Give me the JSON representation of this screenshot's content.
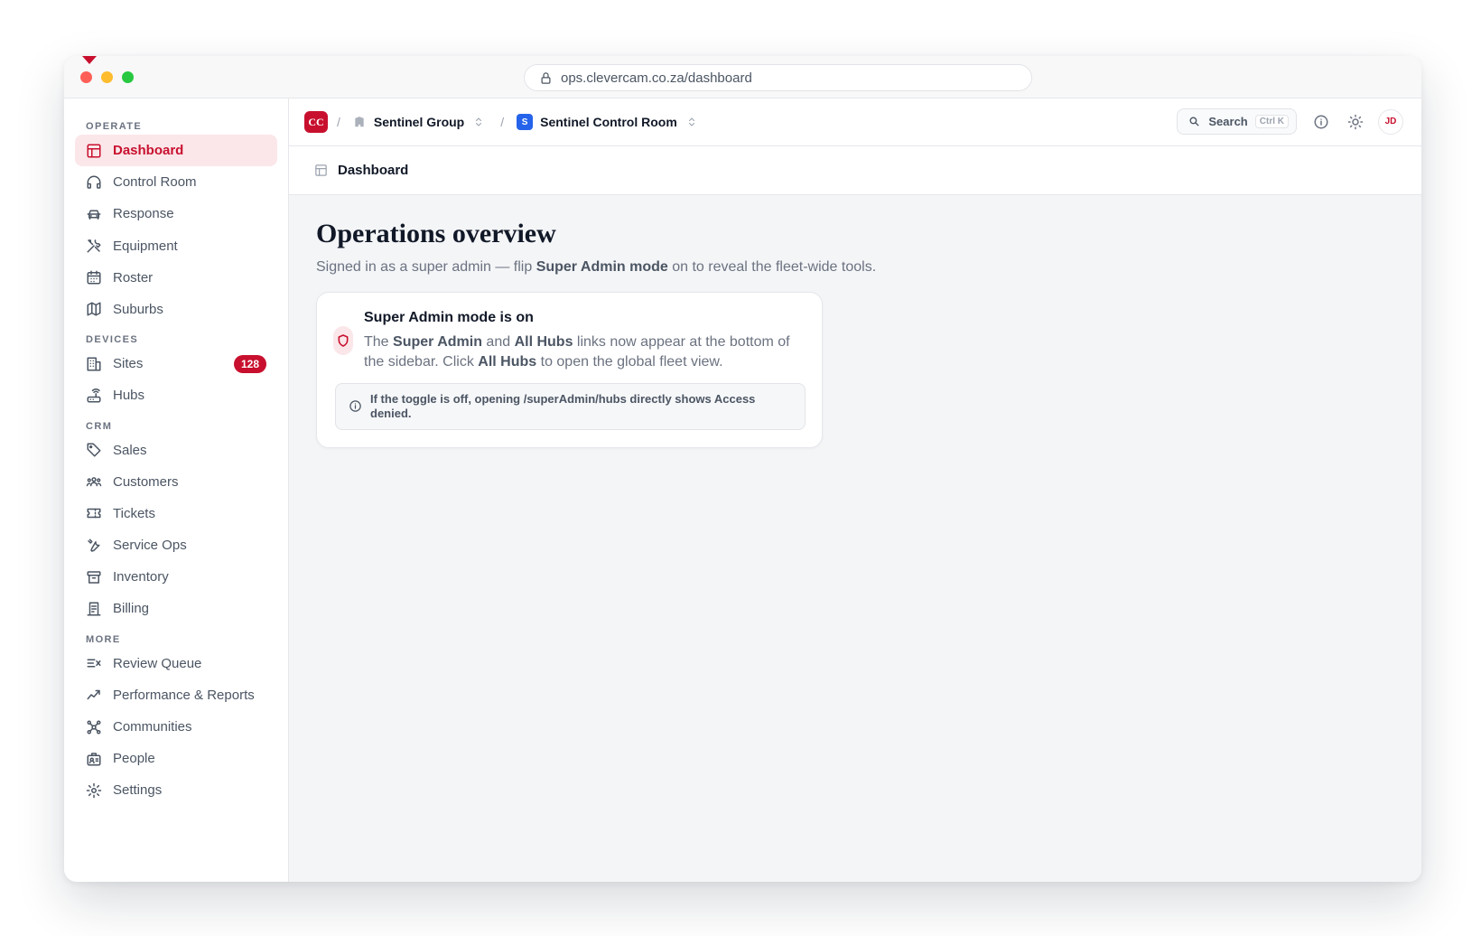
{
  "browser": {
    "url": "ops.clevercam.co.za/dashboard"
  },
  "sidebar": {
    "sections": [
      {
        "label": "OPERATE",
        "items": [
          {
            "label": "Dashboard",
            "icon": "layout-icon",
            "active": true
          },
          {
            "label": "Control Room",
            "icon": "headset-icon"
          },
          {
            "label": "Response",
            "icon": "car-icon"
          },
          {
            "label": "Equipment",
            "icon": "tools-icon"
          },
          {
            "label": "Roster",
            "icon": "calendar-icon"
          },
          {
            "label": "Suburbs",
            "icon": "map-icon"
          }
        ]
      },
      {
        "label": "DEVICES",
        "items": [
          {
            "label": "Sites",
            "icon": "building-icon",
            "badge": "128"
          },
          {
            "label": "Hubs",
            "icon": "router-icon"
          }
        ]
      },
      {
        "label": "CRM",
        "items": [
          {
            "label": "Sales",
            "icon": "tag-icon"
          },
          {
            "label": "Customers",
            "icon": "users-icon"
          },
          {
            "label": "Tickets",
            "icon": "ticket-icon"
          },
          {
            "label": "Service Ops",
            "icon": "wrench-icon"
          },
          {
            "label": "Inventory",
            "icon": "archive-icon"
          },
          {
            "label": "Billing",
            "icon": "receipt-icon"
          }
        ]
      },
      {
        "label": "MORE",
        "items": [
          {
            "label": "Review Queue",
            "icon": "list-check-icon"
          },
          {
            "label": "Performance & Reports",
            "icon": "trend-icon"
          },
          {
            "label": "Communities",
            "icon": "network-icon"
          },
          {
            "label": "People",
            "icon": "id-badge-icon"
          },
          {
            "label": "Settings",
            "icon": "gear-icon"
          }
        ]
      }
    ]
  },
  "topbar": {
    "logo": "CC",
    "separator": "/",
    "org": "Sentinel Group",
    "room_badge": "S",
    "room": "Sentinel Control Room",
    "search_label": "Search",
    "search_shortcut": "Ctrl K",
    "avatar_initials": "JD"
  },
  "subheader": {
    "title": "Dashboard"
  },
  "main": {
    "title": "Operations overview",
    "subtitle_pre": "Signed in as a super admin — flip ",
    "subtitle_bold": "Super Admin mode",
    "subtitle_post": " on to reveal the fleet-wide tools."
  },
  "card": {
    "title": "Super Admin mode is on",
    "body_1": "The ",
    "body_b1": "Super Admin",
    "body_2": " and ",
    "body_b2": "All Hubs",
    "body_3": " links now appear at the bottom of the sidebar. Click ",
    "body_b3": "All Hubs",
    "body_4": " to open the global fleet view.",
    "note": "If the toggle is off, opening /superAdmin/hubs directly shows Access denied."
  },
  "colors": {
    "accent": "#c8102e",
    "accent_soft": "#fbe7ea",
    "room_blue": "#2563eb"
  }
}
